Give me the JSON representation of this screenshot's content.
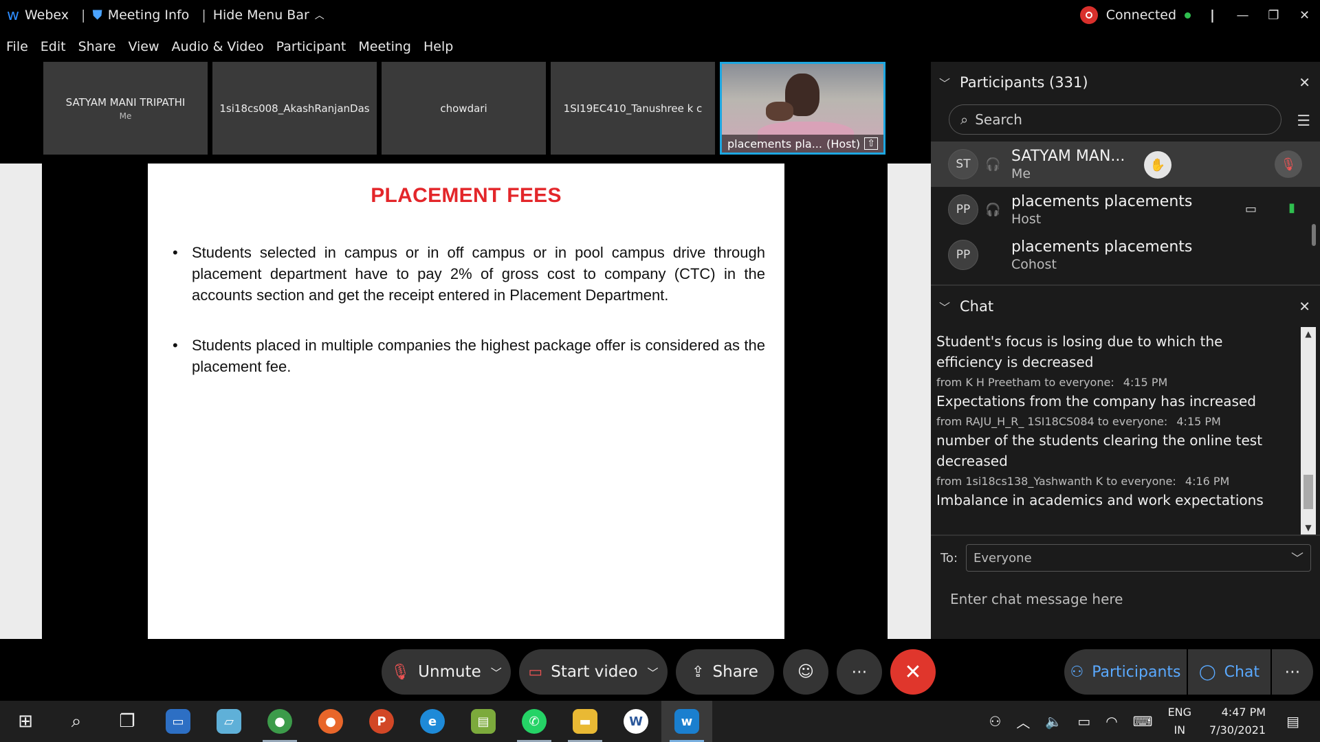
{
  "titlebar": {
    "app_name": "Webex",
    "meeting_info": "Meeting Info",
    "hide_menu": "Hide Menu Bar",
    "status": "Connected"
  },
  "menubar": [
    "File",
    "Edit",
    "Share",
    "View",
    "Audio & Video",
    "Participant",
    "Meeting",
    "Help"
  ],
  "thumbnails": [
    {
      "name": "SATYAM MANI TRIPATHI",
      "sub": "Me"
    },
    {
      "name": "1si18cs008_AkashRanjanDas"
    },
    {
      "name": "chowdari"
    },
    {
      "name": "1SI19EC410_Tanushree k c"
    }
  ],
  "video_thumb": {
    "name": "placements pla...",
    "role": "(Host)"
  },
  "slide": {
    "title": "PLACEMENT FEES",
    "bullets": [
      "Students selected in campus or in off campus or in pool campus drive through placement department have to pay 2% of gross cost to company (CTC) in the accounts section and get the receipt entered in Placement Department.",
      "Students placed in multiple companies the highest package offer is considered as the placement fee."
    ]
  },
  "participants": {
    "header": "Participants (331)",
    "search_placeholder": "Search",
    "items": [
      {
        "initials": "ST",
        "name": "SATYAM MAN...",
        "role": "Me"
      },
      {
        "initials": "PP",
        "name": "placements placements",
        "role": "Host"
      },
      {
        "initials": "PP",
        "name": "placements placements",
        "role": "Cohost"
      }
    ]
  },
  "chat": {
    "header": "Chat",
    "messages": [
      {
        "text": "Student's focus is losing due to which the efficiency is decreased",
        "from": "from K H Preetham to everyone:",
        "time": "4:15 PM"
      },
      {
        "text": "Expectations from the company has increased",
        "from": "from RAJU_H_R_ 1SI18CS084 to everyone:",
        "time": "4:15 PM"
      },
      {
        "text": "number of the students clearing the online test decreased",
        "from": "from 1si18cs138_Yashwanth K to everyone:",
        "time": "4:16 PM"
      },
      {
        "text": "Imbalance in academics and work expectations"
      }
    ],
    "to_label": "To:",
    "to_value": "Everyone",
    "input_placeholder": "Enter chat message here"
  },
  "controls": {
    "unmute": "Unmute",
    "start_video": "Start video",
    "share": "Share",
    "participants": "Participants",
    "chat": "Chat"
  },
  "taskbar": {
    "lang1": "ENG",
    "lang2": "IN",
    "time": "4:47 PM",
    "date": "7/30/2021"
  },
  "colors": {
    "accent": "#1ea7e1",
    "end_call": "#e0362c",
    "slide_title": "#e3262a",
    "link_blue": "#5aa9ff"
  }
}
